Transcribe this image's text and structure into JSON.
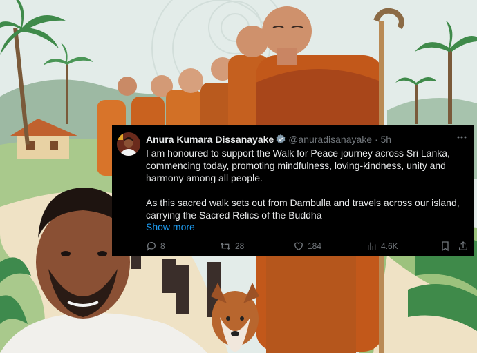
{
  "tweet": {
    "name": "Anura Kumara Dissanayake",
    "handle": "@anuradisanayake",
    "separator": "·",
    "time": "5h",
    "paragraphs": [
      "I am honoured to support the Walk for Peace journey across Sri Lanka, commencing today, promoting mindfulness, loving-kindness, unity and harmony among all people.",
      "As this sacred walk sets out from Dambulla and travels across our island, carrying the Sacred Relics of the Buddha"
    ],
    "show_more": "Show more",
    "replies": "8",
    "reposts": "28",
    "likes": "184",
    "views": "4.6K",
    "accent_color": "#1d9bf0"
  }
}
